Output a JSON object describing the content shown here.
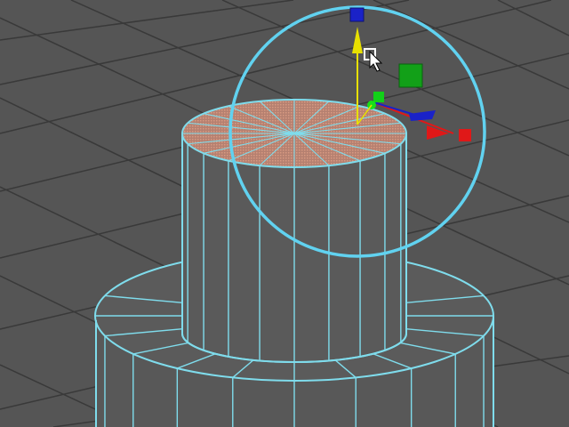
{
  "viewport": {
    "background": "#555555",
    "grid_color": "#393939",
    "wire_color": "#7fdcec",
    "mesh_face": "#5a5a5a",
    "mesh_face_dark": "#4b4b4b",
    "selected_face_color": "#c88a70"
  },
  "manipulator": {
    "type": "combined move/rotate/scale",
    "x_axis_color": "#e01818",
    "y_axis_color": "#e8e000",
    "z_axis_color": "#1a22c8",
    "y_handle_color": "#1a22c8",
    "plane_handle_color": "#12a018",
    "rotate_ring_color": "#61d2f0"
  },
  "cursor": {
    "icon": "move-cursor-icon"
  },
  "scene": {
    "objects": [
      "cylinder-top",
      "cylinder-base"
    ],
    "selection": "top-face"
  }
}
